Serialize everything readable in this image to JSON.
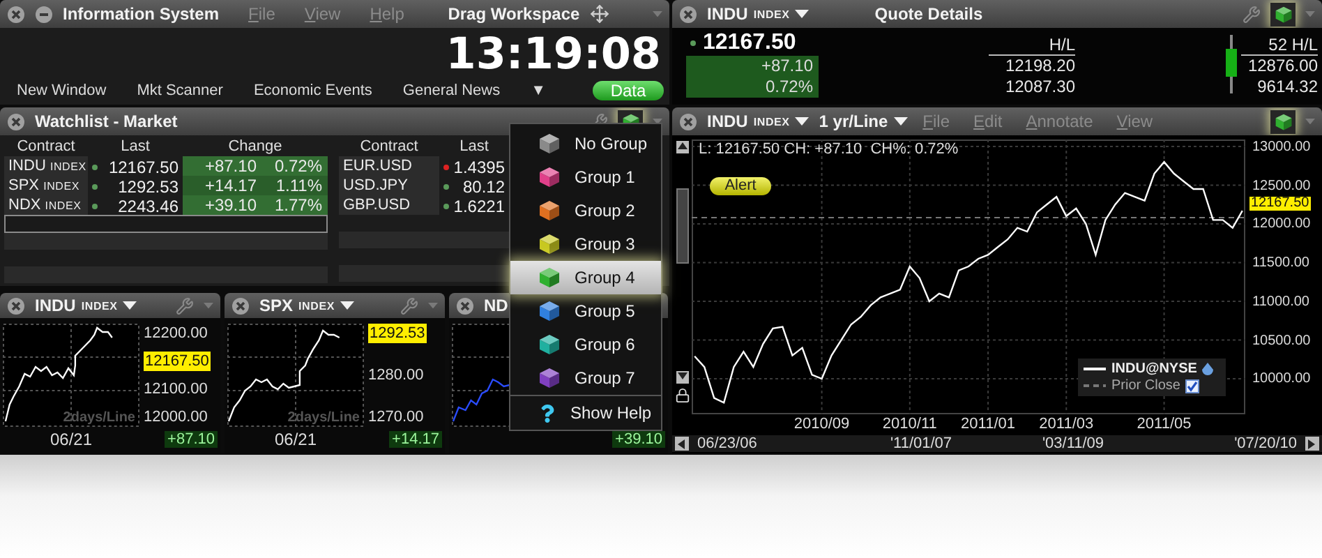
{
  "info_window": {
    "title": "Information System",
    "menu": [
      "File",
      "View",
      "Help"
    ],
    "drag_label": "Drag Workspace",
    "clock": "13:19:08",
    "toolbar": [
      "New Window",
      "Mkt Scanner",
      "Economic Events",
      "General News"
    ],
    "more": "▼",
    "data_button": "Data"
  },
  "watchlist": {
    "title": "Watchlist - Market",
    "left_columns": [
      "Contract",
      "Last",
      "Change"
    ],
    "left_rows": [
      {
        "symbol": "INDU",
        "type": "INDEX",
        "last": "12167.50",
        "change": "+87.10",
        "percent": "0.72%",
        "color": "#5a9a5a"
      },
      {
        "symbol": "SPX",
        "type": "INDEX",
        "last": "1292.53",
        "change": "+14.17",
        "percent": "1.11%",
        "color": "#5a9a5a"
      },
      {
        "symbol": "NDX",
        "type": "INDEX",
        "last": "2243.46",
        "change": "+39.10",
        "percent": "1.77%",
        "color": "#5a9a5a"
      }
    ],
    "right_columns": [
      "Contract",
      "Last"
    ],
    "right_rows": [
      {
        "symbol": "EUR.USD",
        "last": "1.4395",
        "color": "#dd2222"
      },
      {
        "symbol": "USD.JPY",
        "last": "80.12",
        "color": "#5a9a5a"
      },
      {
        "symbol": "GBP.USD",
        "last": "1.6221",
        "color": "#5a9a5a"
      }
    ]
  },
  "mini_charts": [
    {
      "symbol": "INDU",
      "type": "INDEX",
      "axis": [
        {
          "kind": "tick",
          "text": "12200.00"
        },
        {
          "kind": "last",
          "text": "12167.50"
        },
        {
          "kind": "tick",
          "text": "12100.00"
        },
        {
          "kind": "tick",
          "text": "12000.00"
        }
      ],
      "caption": "2days/Line",
      "date": "06/21",
      "change": "+87.10",
      "color": "#ffffff"
    },
    {
      "symbol": "SPX",
      "type": "INDEX",
      "axis": [
        {
          "kind": "last",
          "text": "1292.53"
        },
        {
          "kind": "tick",
          "text": "1280.00"
        },
        {
          "kind": "tick",
          "text": "1270.00"
        }
      ],
      "caption": "2days/Line",
      "date": "06/21",
      "change": "+14.17",
      "color": "#ffffff"
    },
    {
      "symbol": "ND",
      "change": "+39.10",
      "color": "#2a4cff"
    }
  ],
  "group_menu": {
    "items": [
      {
        "label": "No Group",
        "color": "#8a8a8a",
        "selected": false
      },
      {
        "label": "Group 1",
        "color": "#e0408a",
        "selected": false
      },
      {
        "label": "Group 2",
        "color": "#e07020",
        "selected": false
      },
      {
        "label": "Group 3",
        "color": "#c8c820",
        "selected": false
      },
      {
        "label": "Group 4",
        "color": "#30b030",
        "selected": true
      },
      {
        "label": "Group 5",
        "color": "#3080e0",
        "selected": false
      },
      {
        "label": "Group 6",
        "color": "#20b0a0",
        "selected": false
      },
      {
        "label": "Group 7",
        "color": "#8040c0",
        "selected": false
      }
    ],
    "help": "Show Help"
  },
  "quote": {
    "symbol": "INDU",
    "type": "INDEX",
    "title": "Quote Details",
    "last": "12167.50",
    "change": "+87.10",
    "percent": "0.72%",
    "hl_label": "H/L",
    "high": "12198.20",
    "low": "12087.30",
    "range_label": "52 H/L",
    "range_high": "12876.00",
    "range_low": "9614.32"
  },
  "chart": {
    "symbol": "INDU",
    "type": "INDEX",
    "period": "1 yr/Line",
    "menu": [
      "File",
      "Edit",
      "Annotate",
      "View"
    ],
    "info": "L: 12167.50 CH: +87.10  CH%: 0.72%",
    "alert": "Alert",
    "last_tag": "12167.50",
    "legend": [
      {
        "kind": "line"
      },
      {
        "label": "Prior Close",
        "kind": "dashed",
        "checked": true
      }
    ],
    "navigator": [
      "06/23/06",
      "'11/01/07",
      "'03/11/09",
      "'07/20/10"
    ],
    "chart_data": {
      "type": "line",
      "grid": true,
      "ylim": [
        9540,
        13090
      ],
      "categories": [
        null,
        null,
        null,
        null,
        null,
        null,
        null,
        null,
        null,
        null,
        null,
        null,
        null,
        "2010/09",
        null,
        null,
        null,
        null,
        null,
        null,
        null,
        null,
        "2010/11",
        null,
        null,
        null,
        null,
        null,
        null,
        null,
        "2011/01",
        null,
        null,
        null,
        null,
        null,
        null,
        null,
        "2011/03",
        null,
        null,
        null,
        null,
        null,
        null,
        null,
        null,
        null,
        "2011/05",
        null,
        null,
        null,
        null,
        null,
        null,
        null,
        null
      ],
      "series": [
        {
          "name": "INDU@NYSE",
          "color": "#ffffff",
          "values": [
            10290,
            10150,
            9750,
            9690,
            10150,
            10350,
            10150,
            10450,
            10650,
            10670,
            10300,
            10400,
            10050,
            10000,
            10300,
            10500,
            10700,
            10800,
            10950,
            11050,
            11100,
            11150,
            11450,
            11300,
            11000,
            11100,
            11050,
            11400,
            11450,
            11550,
            11600,
            11700,
            11800,
            11950,
            11900,
            12150,
            12250,
            12350,
            12100,
            12200,
            12000,
            11600,
            12050,
            12250,
            12400,
            12350,
            12300,
            12650,
            12800,
            12650,
            12550,
            12450,
            12450,
            12050,
            12050,
            11950,
            12170
          ]
        }
      ],
      "yticks": [
        {
          "value": 13000,
          "label": "13000.00"
        },
        {
          "value": 12500,
          "label": "12500.00"
        },
        {
          "value": 12000,
          "label": "12000.00"
        },
        {
          "value": 11500,
          "label": "11500.00"
        },
        {
          "value": 11000,
          "label": "11000.00"
        },
        {
          "value": 10500,
          "label": "10500.00"
        },
        {
          "value": 10000,
          "label": "10000.00"
        }
      ],
      "ref_lines": [
        {
          "axis": "y",
          "value": 12080
        }
      ]
    }
  }
}
